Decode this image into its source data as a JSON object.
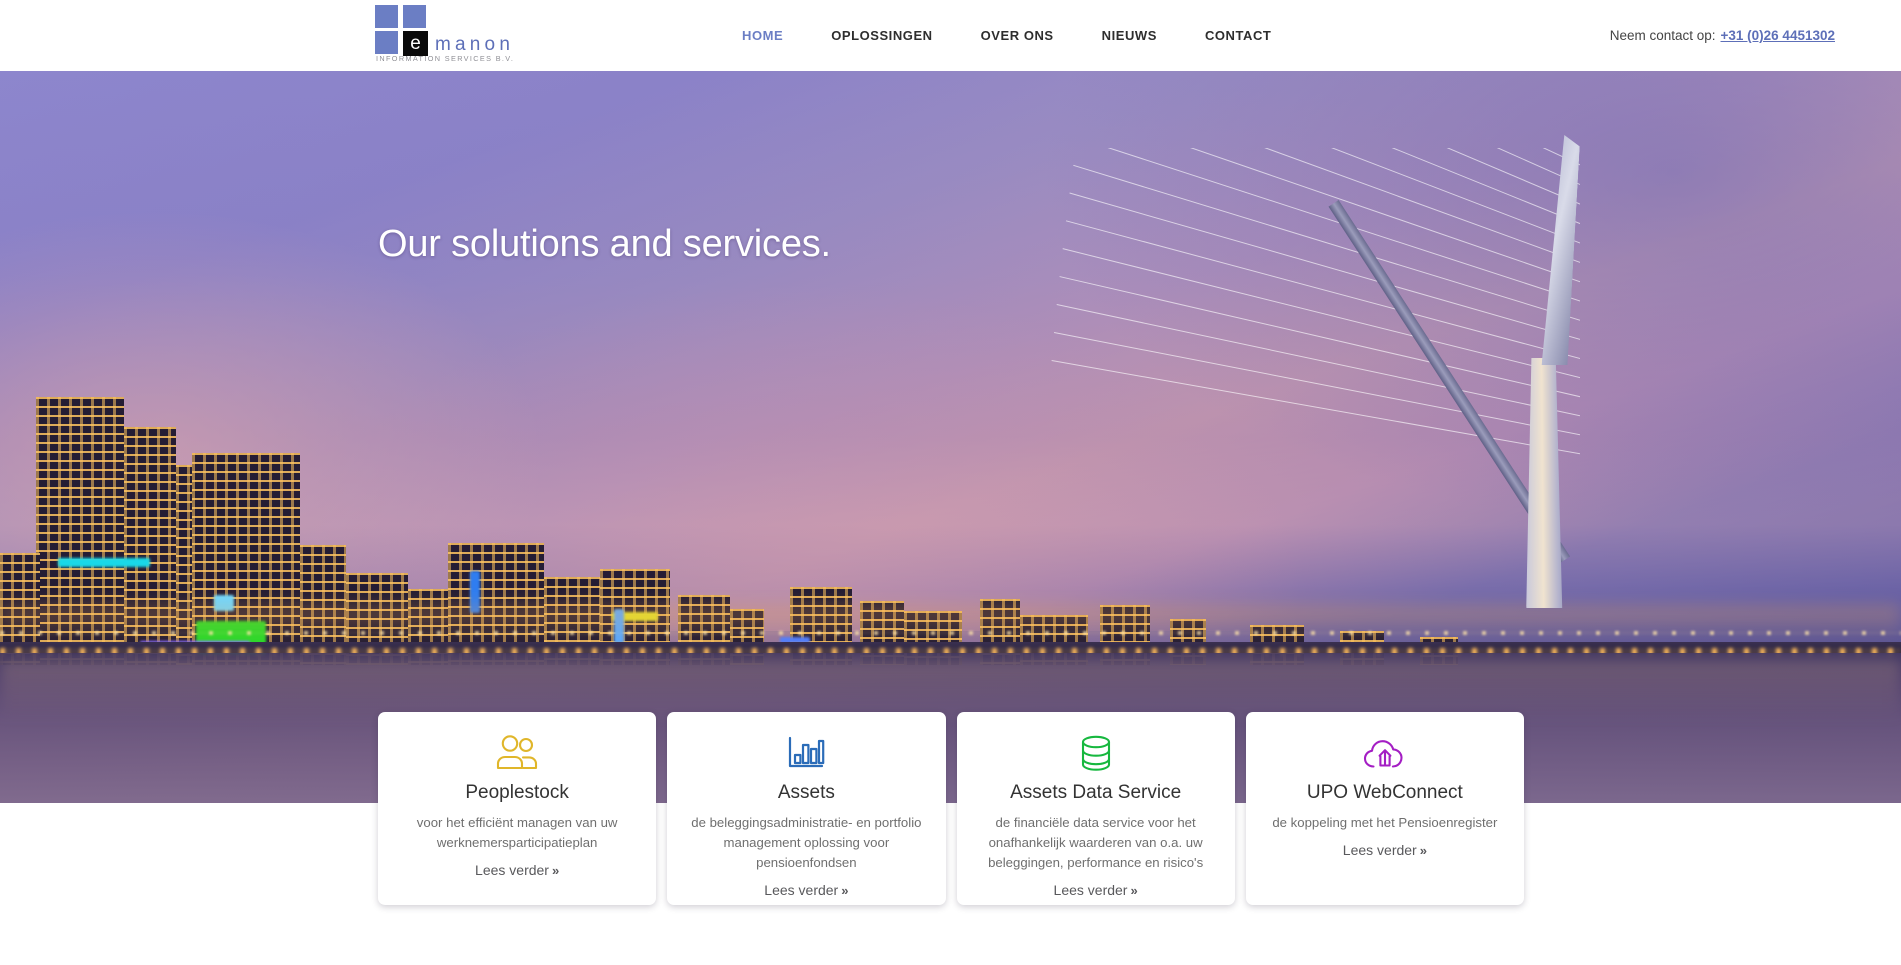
{
  "header": {
    "logo": {
      "mark_letter": "e",
      "word": "manon",
      "subtitle": "INFORMATION SERVICES B.V.",
      "square_color": "#6b7ec4",
      "word_color": "#5d6fb8"
    },
    "nav": [
      {
        "label": "HOME",
        "active": true
      },
      {
        "label": "OPLOSSINGEN",
        "active": false
      },
      {
        "label": "OVER ONS",
        "active": false
      },
      {
        "label": "NIEUWS",
        "active": false
      },
      {
        "label": "CONTACT",
        "active": false
      }
    ],
    "contact": {
      "prefix": "Neem contact op:",
      "phone": "+31 (0)26 4451302",
      "phone_color": "#5d6fb8"
    }
  },
  "hero": {
    "title": "Our solutions and services.",
    "image_description": "Erasmus Bridge Rotterdam skyline at dusk"
  },
  "cards": [
    {
      "icon": "people-icon",
      "icon_color": "#e0b62a",
      "title": "Peoplestock",
      "desc": "voor het efficiënt managen van uw werknemersparticipatieplan",
      "link": "Lees verder",
      "chevron": "»"
    },
    {
      "icon": "bar-chart-icon",
      "icon_color": "#2b6cb8",
      "title": "Assets",
      "desc": "de beleggingsadministratie- en portfolio management oplossing voor pensioenfondsen",
      "link": "Lees verder",
      "chevron": "»"
    },
    {
      "icon": "database-icon",
      "icon_color": "#17b83f",
      "title": "Assets Data Service",
      "desc": "de financiële data service voor het onafhankelijk waarderen van o.a. uw beleggingen, performance en risico's",
      "link": "Lees verder",
      "chevron": "»"
    },
    {
      "icon": "cloud-upload-icon",
      "icon_color": "#a41ec4",
      "title": "UPO WebConnect",
      "desc": "de koppeling met het Pensioenregister",
      "link": "Lees verder",
      "chevron": "»"
    }
  ]
}
